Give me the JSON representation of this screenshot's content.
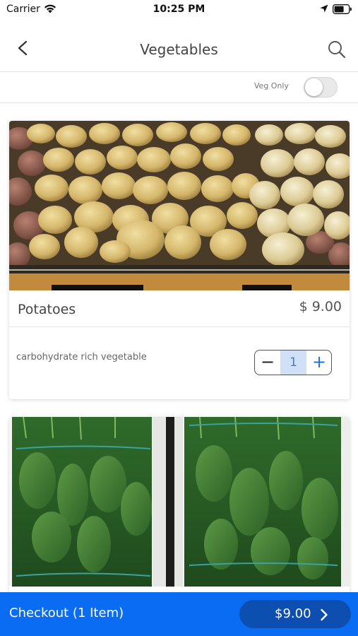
{
  "status_bar": {
    "carrier": "Carrier",
    "time": "10:25 PM"
  },
  "nav": {
    "title": "Vegetables",
    "back_icon": "chevron-left-icon",
    "search_icon": "search-icon"
  },
  "filter": {
    "veg_only_label": "Veg Only",
    "veg_only_enabled": false
  },
  "products": [
    {
      "name": "Potatoes",
      "price": "$ 9.00",
      "description": "carbohydrate rich vegetable",
      "quantity": "1",
      "image": "potatoes-photo"
    },
    {
      "image": "spinach-photo"
    }
  ],
  "checkout": {
    "label": "Checkout (1 Item)",
    "total": "$9.00"
  },
  "colors": {
    "accent": "#0a6cf2",
    "checkout_pill": "#0d4fb0",
    "stepper_highlight": "#cfe0f7"
  }
}
